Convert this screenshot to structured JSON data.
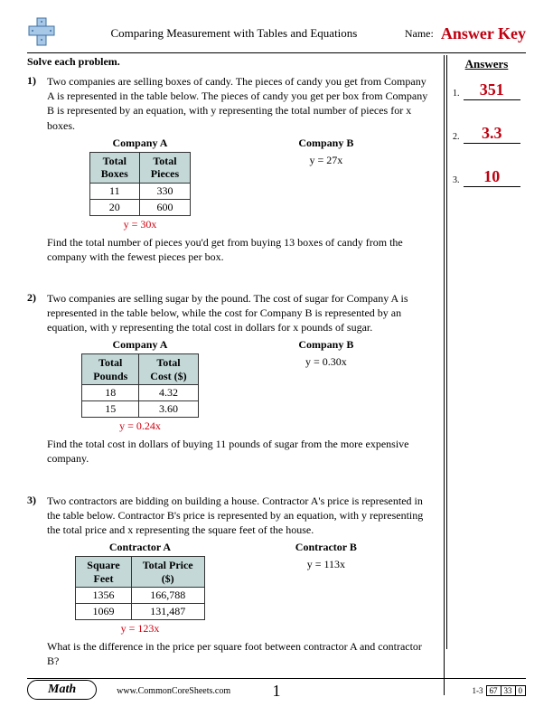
{
  "header": {
    "title": "Comparing Measurement with Tables and Equations",
    "name_label": "Name:",
    "answer_key": "Answer Key"
  },
  "instructions": "Solve each problem.",
  "answers_heading": "Answers",
  "answers": [
    {
      "num": "1.",
      "value": "351"
    },
    {
      "num": "2.",
      "value": "3.3"
    },
    {
      "num": "3.",
      "value": "10"
    }
  ],
  "problems": [
    {
      "num": "1)",
      "text": "Two companies are selling boxes of candy. The pieces of candy you get from Company A is represented in the table below. The pieces of candy you get per box from Company B is represented by an equation, with y representing the total number of pieces for x boxes.",
      "company_a": {
        "title": "Company A",
        "col1": "Total\nBoxes",
        "col2": "Total\nPieces",
        "rows": [
          [
            "11",
            "330"
          ],
          [
            "20",
            "600"
          ]
        ],
        "eq": "y = 30x"
      },
      "company_b": {
        "title": "Company B",
        "eq": "y = 27x"
      },
      "conclusion": "Find the total number of pieces you'd get from buying 13 boxes of candy from the company with the fewest pieces per box."
    },
    {
      "num": "2)",
      "text": "Two companies are selling sugar by the pound. The cost of sugar for Company A is represented in the table below, while the cost for Company B is represented by an equation, with y representing the total cost in dollars for x pounds of sugar.",
      "company_a": {
        "title": "Company A",
        "col1": "Total\nPounds",
        "col2": "Total\nCost ($)",
        "rows": [
          [
            "18",
            "4.32"
          ],
          [
            "15",
            "3.60"
          ]
        ],
        "eq": "y = 0.24x"
      },
      "company_b": {
        "title": "Company B",
        "eq": "y = 0.30x"
      },
      "conclusion": "Find the total cost in dollars of buying 11 pounds of sugar from the more expensive company."
    },
    {
      "num": "3)",
      "text": "Two contractors are bidding on building a house. Contractor A's price is represented in the table below. Contractor B's price is represented by an equation, with y representing the total price and x representing the square feet of the house.",
      "company_a": {
        "title": "Contractor A",
        "col1": "Square\nFeet",
        "col2": "Total Price\n($)",
        "rows": [
          [
            "1356",
            "166,788"
          ],
          [
            "1069",
            "131,487"
          ]
        ],
        "eq": "y = 123x"
      },
      "company_b": {
        "title": "Contractor B",
        "eq": "y = 113x"
      },
      "conclusion": "What is the difference in the price per square foot between contractor A and contractor B?"
    }
  ],
  "footer": {
    "subject": "Math",
    "url": "www.CommonCoreSheets.com",
    "page": "1",
    "range": "1-3",
    "scores": [
      "67",
      "33",
      "0"
    ]
  }
}
